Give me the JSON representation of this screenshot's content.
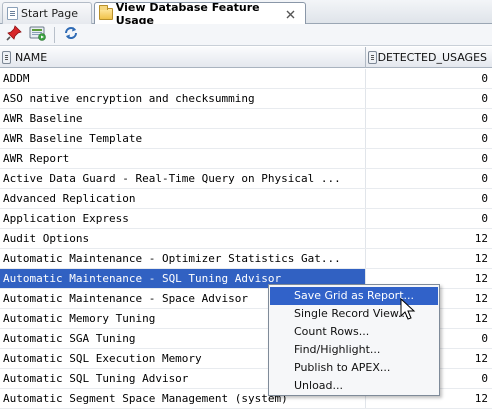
{
  "tabs": [
    {
      "label": "Start Page",
      "icon": "page-icon",
      "active": false
    },
    {
      "label": "View Database Feature Usage",
      "icon": "folder-icon",
      "active": true
    }
  ],
  "toolbar": {
    "pin_icon": "pin-icon",
    "run_icon": "sql-run-icon",
    "refresh_icon": "refresh-icon"
  },
  "grid": {
    "columns": [
      "NAME",
      "DETECTED_USAGES"
    ],
    "rows": [
      {
        "name": "ADDM",
        "value": "0"
      },
      {
        "name": "ASO native encryption and checksumming",
        "value": "0"
      },
      {
        "name": "AWR Baseline",
        "value": "0"
      },
      {
        "name": "AWR Baseline Template",
        "value": "0"
      },
      {
        "name": "AWR Report",
        "value": "0"
      },
      {
        "name": "Active Data Guard - Real-Time Query on Physical ...",
        "value": "0"
      },
      {
        "name": "Advanced Replication",
        "value": "0"
      },
      {
        "name": "Application Express",
        "value": "0"
      },
      {
        "name": "Audit Options",
        "value": "12"
      },
      {
        "name": "Automatic Maintenance - Optimizer Statistics Gat...",
        "value": "12"
      },
      {
        "name": "Automatic Maintenance - SQL Tuning Advisor",
        "value": "12"
      },
      {
        "name": "Automatic Maintenance - Space Advisor",
        "value": "12"
      },
      {
        "name": "Automatic Memory Tuning",
        "value": "12"
      },
      {
        "name": "Automatic SGA Tuning",
        "value": "0"
      },
      {
        "name": "Automatic SQL Execution Memory",
        "value": "12"
      },
      {
        "name": "Automatic SQL Tuning Advisor",
        "value": "0"
      },
      {
        "name": "Automatic Segment Space Management (system)",
        "value": "12"
      }
    ],
    "selected_row": "Automatic Maintenance - SQL Tuning Advisor"
  },
  "context_menu": {
    "items": [
      "Save Grid as Report...",
      "Single Record View...",
      "Count Rows...",
      "Find/Highlight...",
      "Publish to APEX...",
      "Unload..."
    ],
    "highlighted": "Save Grid as Report..."
  },
  "colors": {
    "selection": "#3161c2",
    "menu_highlight": "#3162c9"
  }
}
